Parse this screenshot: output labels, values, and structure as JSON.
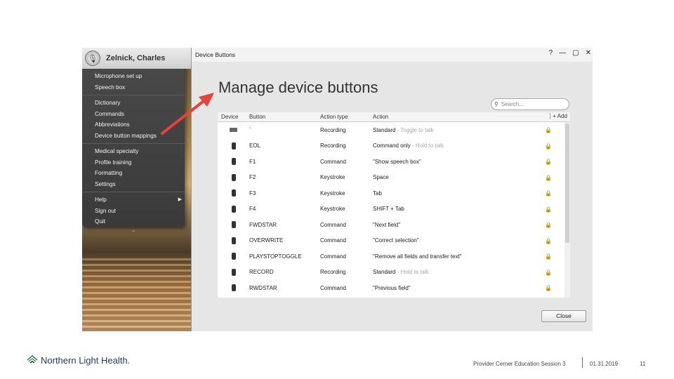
{
  "menu": {
    "user_name": "Zelnick, Charles",
    "groups": [
      [
        "Microphone set up",
        "Speech box"
      ],
      [
        "Dictionary",
        "Commands",
        "Abbreviations",
        "Device button mappings"
      ],
      [
        "Medical specialty",
        "Profile training",
        "Formatting",
        "Settings"
      ],
      [
        "Help",
        "Sign out",
        "Quit"
      ]
    ],
    "more_glyph": "⌃"
  },
  "dialog": {
    "window_title": "Device Buttons",
    "help_btn": "?",
    "heading": "Manage device buttons",
    "search_placeholder": "Search...",
    "columns": [
      "Device",
      "Button",
      "Action type",
      "Action"
    ],
    "add_label": "+ Add",
    "rows": [
      {
        "device": "keyboard-icon",
        "button": "`",
        "type": "Recording",
        "action": "Standard",
        "note": " - Toggle to talk"
      },
      {
        "device": "microphone-icon",
        "button": "EOL",
        "type": "Recording",
        "action": "Command only",
        "note": " - Hold to talk"
      },
      {
        "device": "microphone-icon",
        "button": "F1",
        "type": "Command",
        "action": "\"Show speech box\"",
        "note": ""
      },
      {
        "device": "microphone-icon",
        "button": "F2",
        "type": "Keystroke",
        "action": "Space",
        "note": ""
      },
      {
        "device": "microphone-icon",
        "button": "F3",
        "type": "Keystroke",
        "action": "Tab",
        "note": ""
      },
      {
        "device": "microphone-icon",
        "button": "F4",
        "type": "Keystroke",
        "action": "SHIFT + Tab",
        "note": ""
      },
      {
        "device": "microphone-icon",
        "button": "FWDSTAR",
        "type": "Command",
        "action": "\"Next field\"",
        "note": ""
      },
      {
        "device": "microphone-icon",
        "button": "OVERWRITE",
        "type": "Command",
        "action": "\"Correct selection\"",
        "note": ""
      },
      {
        "device": "microphone-icon",
        "button": "PLAYSTOPTOGGLE",
        "type": "Command",
        "action": "\"Remove all fields and transfer text\"",
        "note": ""
      },
      {
        "device": "microphone-icon",
        "button": "RECORD",
        "type": "Recording",
        "action": "Standard",
        "note": " - Hold to talk"
      },
      {
        "device": "microphone-icon",
        "button": "RWDSTAR",
        "type": "Command",
        "action": "\"Previous field\"",
        "note": ""
      }
    ],
    "close_label": "Close"
  },
  "footer": {
    "org": "Northern Light Health.",
    "session": "Provider Cerner Education Session 3",
    "date": "01.31.2019",
    "page": "11"
  },
  "colors": {
    "annotation_arrow": "#e8413c",
    "brand": "#1d3f6e"
  }
}
